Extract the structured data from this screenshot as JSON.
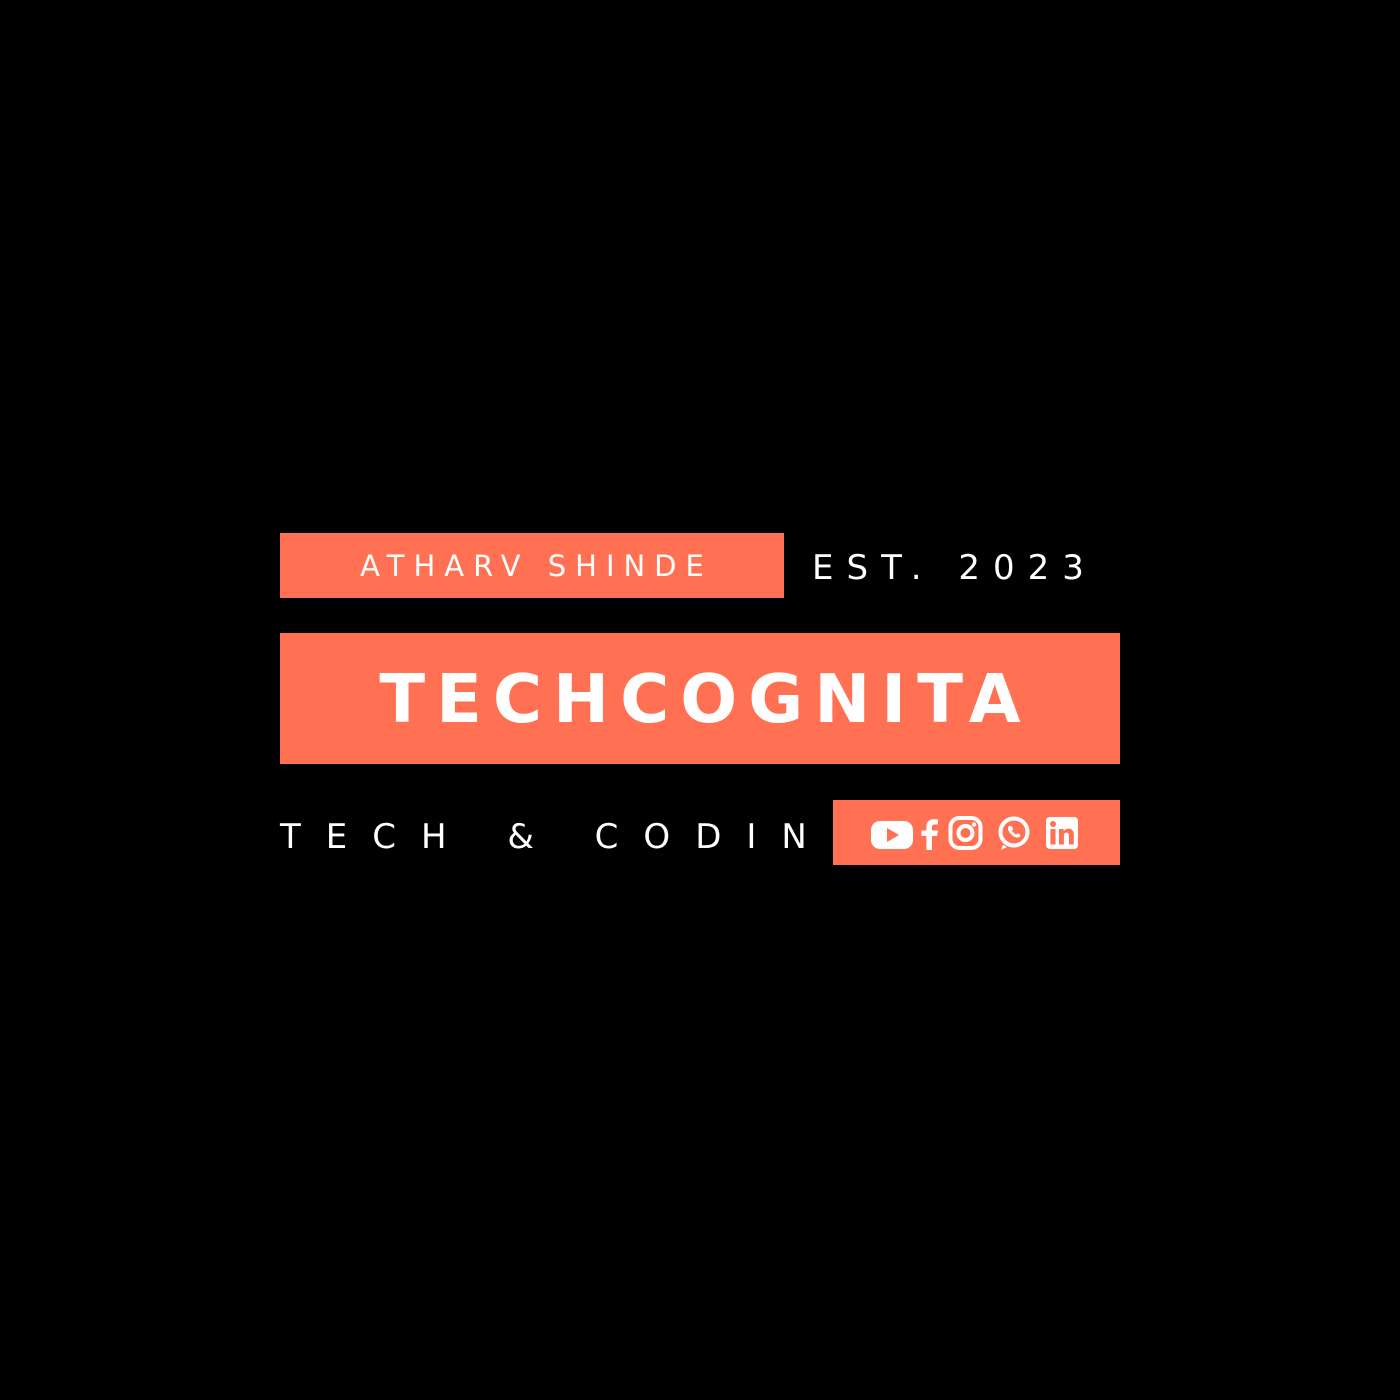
{
  "brand": {
    "author": "ATHARV SHINDE",
    "established": "EST. 2023",
    "title": "TECHCOGNITA",
    "tagline": "TECH & CODING"
  },
  "social": {
    "icons": [
      "youtube-icon",
      "facebook-icon",
      "instagram-icon",
      "whatsapp-icon",
      "linkedin-icon"
    ]
  },
  "colors": {
    "background": "#000000",
    "accent": "#ff7152",
    "text": "#ffffff"
  }
}
